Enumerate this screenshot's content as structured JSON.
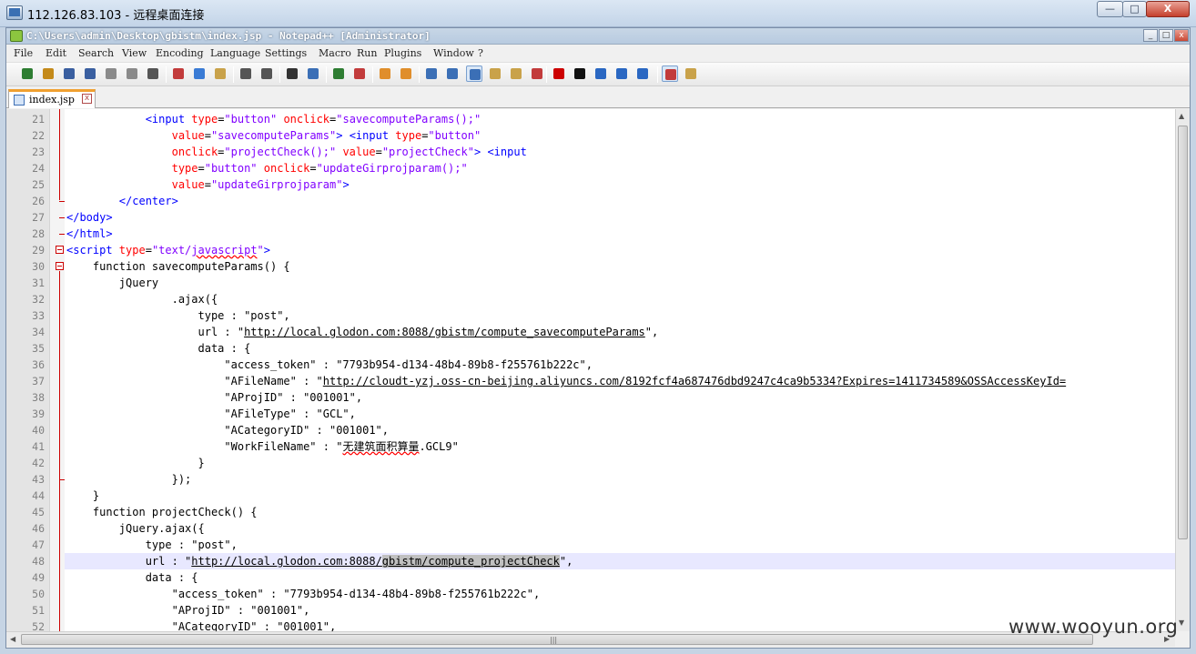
{
  "remote_window": {
    "title": "112.126.83.103 - 远程桌面连接",
    "minimize_label": "—",
    "maximize_label": "□",
    "close_label": "X"
  },
  "npp_window": {
    "title": "C:\\Users\\admin\\Desktop\\gbistm\\index.jsp - Notepad++ [Administrator]",
    "minimize_label": "_",
    "maximize_label": "□",
    "close_label": "x"
  },
  "menu": [
    "File",
    "Edit",
    "Search",
    "View",
    "Encoding",
    "Language",
    "Settings",
    "Macro",
    "Run",
    "Plugins",
    "Window",
    "?"
  ],
  "toolbar_icons": [
    "new-file-icon",
    "open-file-icon",
    "save-icon",
    "save-all-icon",
    "close-icon",
    "close-all-icon",
    "print-icon",
    "cut-icon",
    "copy-icon",
    "paste-icon",
    "undo-icon",
    "redo-icon",
    "find-icon",
    "replace-icon",
    "zoom-in-icon",
    "zoom-out-icon",
    "sync-vertical-icon",
    "sync-horizontal-icon",
    "word-wrap-icon",
    "show-all-chars-icon",
    "indent-guide-icon",
    "user-lang-icon",
    "doc-map-icon",
    "function-list-icon",
    "record-macro-icon",
    "stop-record-icon",
    "play-macro-icon",
    "run-macro-multiple-icon",
    "save-macro-icon",
    "spell-check-icon",
    "spell-check-options-icon"
  ],
  "tab": {
    "label": "index.jsp",
    "close_label": "x"
  },
  "lines": [
    {
      "n": "21",
      "tokens": [
        {
          "t": "            ",
          "c": "tx"
        },
        {
          "t": "<input",
          "c": "kw"
        },
        {
          "t": " type",
          "c": "at"
        },
        {
          "t": "=",
          "c": "tx"
        },
        {
          "t": "\"button\"",
          "c": "st"
        },
        {
          "t": " onclick",
          "c": "at"
        },
        {
          "t": "=",
          "c": "tx"
        },
        {
          "t": "\"savecomputeParams();\"",
          "c": "st"
        }
      ]
    },
    {
      "n": "22",
      "tokens": [
        {
          "t": "                ",
          "c": "tx"
        },
        {
          "t": "value",
          "c": "at"
        },
        {
          "t": "=",
          "c": "tx"
        },
        {
          "t": "\"savecomputeParams\"",
          "c": "st"
        },
        {
          "t": ">",
          "c": "kw"
        },
        {
          "t": " ",
          "c": "tx"
        },
        {
          "t": "<input",
          "c": "kw"
        },
        {
          "t": " type",
          "c": "at"
        },
        {
          "t": "=",
          "c": "tx"
        },
        {
          "t": "\"button\"",
          "c": "st"
        }
      ]
    },
    {
      "n": "23",
      "tokens": [
        {
          "t": "                ",
          "c": "tx"
        },
        {
          "t": "onclick",
          "c": "at"
        },
        {
          "t": "=",
          "c": "tx"
        },
        {
          "t": "\"projectCheck();\"",
          "c": "st"
        },
        {
          "t": " value",
          "c": "at"
        },
        {
          "t": "=",
          "c": "tx"
        },
        {
          "t": "\"projectCheck\"",
          "c": "st"
        },
        {
          "t": ">",
          "c": "kw"
        },
        {
          "t": " ",
          "c": "tx"
        },
        {
          "t": "<input",
          "c": "kw"
        }
      ]
    },
    {
      "n": "24",
      "tokens": [
        {
          "t": "                ",
          "c": "tx"
        },
        {
          "t": "type",
          "c": "at"
        },
        {
          "t": "=",
          "c": "tx"
        },
        {
          "t": "\"button\"",
          "c": "st"
        },
        {
          "t": " onclick",
          "c": "at"
        },
        {
          "t": "=",
          "c": "tx"
        },
        {
          "t": "\"updateGirprojparam();\"",
          "c": "st"
        }
      ]
    },
    {
      "n": "25",
      "tokens": [
        {
          "t": "                ",
          "c": "tx"
        },
        {
          "t": "value",
          "c": "at"
        },
        {
          "t": "=",
          "c": "tx"
        },
        {
          "t": "\"updateGirprojparam\"",
          "c": "st"
        },
        {
          "t": ">",
          "c": "kw"
        }
      ]
    },
    {
      "n": "26",
      "tokens": [
        {
          "t": "        ",
          "c": "tx"
        },
        {
          "t": "</center>",
          "c": "kw"
        }
      ]
    },
    {
      "n": "27",
      "tokens": [
        {
          "t": "</body>",
          "c": "kw"
        }
      ]
    },
    {
      "n": "28",
      "tokens": [
        {
          "t": "</html>",
          "c": "kw"
        }
      ]
    },
    {
      "n": "29",
      "tokens": [
        {
          "t": "<script",
          "c": "kw"
        },
        {
          "t": " type",
          "c": "at"
        },
        {
          "t": "=",
          "c": "tx"
        },
        {
          "t": "\"text/",
          "c": "st"
        },
        {
          "t": "javascript",
          "c": "st sq"
        },
        {
          "t": "\"",
          "c": "st"
        },
        {
          "t": ">",
          "c": "kw"
        }
      ]
    },
    {
      "n": "30",
      "tokens": [
        {
          "t": "    function savecomputeParams() {",
          "c": "tx"
        }
      ]
    },
    {
      "n": "31",
      "tokens": [
        {
          "t": "        jQuery",
          "c": "tx"
        }
      ]
    },
    {
      "n": "32",
      "tokens": [
        {
          "t": "                .ajax({",
          "c": "tx"
        }
      ]
    },
    {
      "n": "33",
      "tokens": [
        {
          "t": "                    type : \"post\",",
          "c": "tx"
        }
      ]
    },
    {
      "n": "34",
      "tokens": [
        {
          "t": "                    url : \"",
          "c": "tx"
        },
        {
          "t": "http://local.glodon.com:8088/gbistm/compute_savecomputeParams",
          "c": "tx u"
        },
        {
          "t": "\",",
          "c": "tx"
        }
      ]
    },
    {
      "n": "35",
      "tokens": [
        {
          "t": "                    data : {",
          "c": "tx"
        }
      ]
    },
    {
      "n": "36",
      "tokens": [
        {
          "t": "                        \"access_token\" : \"7793b954-d134-48b4-89b8-f255761b222c\",",
          "c": "tx"
        }
      ]
    },
    {
      "n": "37",
      "tokens": [
        {
          "t": "                        \"AFileName\" : \"",
          "c": "tx"
        },
        {
          "t": "http://cloudt-yzj.oss-cn-beijing.aliyuncs.com/8192fcf4a687476dbd9247c4ca9b5334?Expires=1411734589&OSSAccessKeyId=",
          "c": "tx u"
        }
      ]
    },
    {
      "n": "38",
      "tokens": [
        {
          "t": "                        \"AProjID\" : \"001001\",",
          "c": "tx"
        }
      ]
    },
    {
      "n": "39",
      "tokens": [
        {
          "t": "                        \"AFileType\" : \"GCL\",",
          "c": "tx"
        }
      ]
    },
    {
      "n": "40",
      "tokens": [
        {
          "t": "                        \"ACategoryID\" : \"001001\",",
          "c": "tx"
        }
      ]
    },
    {
      "n": "41",
      "tokens": [
        {
          "t": "                        \"WorkFileName\" : \"",
          "c": "tx"
        },
        {
          "t": "无建筑面积算量",
          "c": "tx sq"
        },
        {
          "t": ".GCL9\"",
          "c": "tx"
        }
      ]
    },
    {
      "n": "42",
      "tokens": [
        {
          "t": "                    }",
          "c": "tx"
        }
      ]
    },
    {
      "n": "43",
      "tokens": [
        {
          "t": "                });",
          "c": "tx"
        }
      ]
    },
    {
      "n": "44",
      "tokens": [
        {
          "t": "    }",
          "c": "tx"
        }
      ]
    },
    {
      "n": "45",
      "tokens": [
        {
          "t": "    function projectCheck() {",
          "c": "tx"
        }
      ]
    },
    {
      "n": "46",
      "tokens": [
        {
          "t": "        jQuery.ajax({",
          "c": "tx"
        }
      ]
    },
    {
      "n": "47",
      "tokens": [
        {
          "t": "            type : \"post\",",
          "c": "tx"
        }
      ]
    },
    {
      "n": "48",
      "tokens": [
        {
          "t": "            url : \"",
          "c": "tx"
        },
        {
          "t": "http://local.glodon.com:8088/",
          "c": "tx u"
        },
        {
          "t": "gbistm/compute_projectCheck",
          "c": "tx u sel"
        },
        {
          "t": "\",",
          "c": "tx"
        }
      ]
    },
    {
      "n": "49",
      "tokens": [
        {
          "t": "            data : {",
          "c": "tx"
        }
      ]
    },
    {
      "n": "50",
      "tokens": [
        {
          "t": "                \"access_token\" : \"7793b954-d134-48b4-89b8-f255761b222c\",",
          "c": "tx"
        }
      ]
    },
    {
      "n": "51",
      "tokens": [
        {
          "t": "                \"AProjID\" : \"001001\",",
          "c": "tx"
        }
      ]
    },
    {
      "n": "52",
      "tokens": [
        {
          "t": "                \"ACategoryID\" : \"001001\",",
          "c": "tx"
        }
      ]
    }
  ],
  "current_line": "48",
  "watermark": "www.wooyun.org"
}
